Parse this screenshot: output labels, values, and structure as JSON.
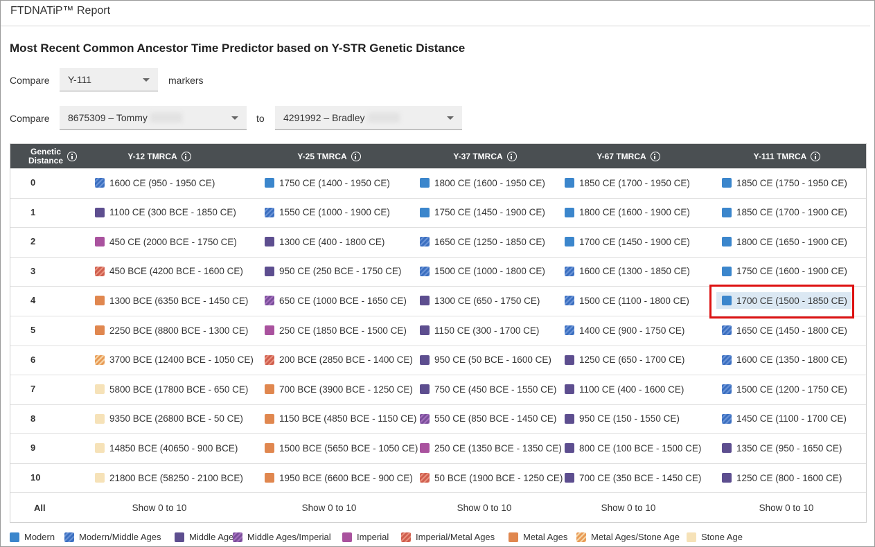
{
  "header": {
    "title": "FTDNATiP™ Report"
  },
  "page_title": "Most Recent Common Ancestor Time Predictor based on Y-STR Genetic Distance",
  "compare_markers": {
    "label": "Compare",
    "value": "Y-111",
    "suffix": "markers"
  },
  "compare_people": {
    "label": "Compare",
    "person1": "8675309 – Tommy",
    "to": "to",
    "person2": "4291992 – Bradley"
  },
  "table": {
    "headers": [
      "Genetic Distance",
      "Y-12 TMRCA",
      "Y-25 TMRCA",
      "Y-37 TMRCA",
      "Y-67 TMRCA",
      "Y-111 TMRCA"
    ],
    "rows": [
      {
        "gd": "0",
        "cells": [
          {
            "text": "1600 CE (950 - 1950 CE)",
            "era": "modern-middle"
          },
          {
            "text": "1750 CE (1400 - 1950 CE)",
            "era": "modern"
          },
          {
            "text": "1800 CE (1600 - 1950 CE)",
            "era": "modern"
          },
          {
            "text": "1850 CE (1700 - 1950 CE)",
            "era": "modern"
          },
          {
            "text": "1850 CE (1750 - 1950 CE)",
            "era": "modern"
          }
        ]
      },
      {
        "gd": "1",
        "cells": [
          {
            "text": "1100 CE (300 BCE - 1850 CE)",
            "era": "middle"
          },
          {
            "text": "1550 CE (1000 - 1900 CE)",
            "era": "modern-middle"
          },
          {
            "text": "1750 CE (1450 - 1900 CE)",
            "era": "modern"
          },
          {
            "text": "1800 CE (1600 - 1900 CE)",
            "era": "modern"
          },
          {
            "text": "1850 CE (1700 - 1900 CE)",
            "era": "modern"
          }
        ]
      },
      {
        "gd": "2",
        "cells": [
          {
            "text": "450 CE (2000 BCE - 1750 CE)",
            "era": "imperial"
          },
          {
            "text": "1300 CE (400 - 1800 CE)",
            "era": "middle"
          },
          {
            "text": "1650 CE (1250 - 1850 CE)",
            "era": "modern-middle"
          },
          {
            "text": "1700 CE (1450 - 1900 CE)",
            "era": "modern"
          },
          {
            "text": "1800 CE (1650 - 1900 CE)",
            "era": "modern"
          }
        ]
      },
      {
        "gd": "3",
        "cells": [
          {
            "text": "450 BCE (4200 BCE - 1600 CE)",
            "era": "imperial-metal"
          },
          {
            "text": "950 CE (250 BCE - 1750 CE)",
            "era": "middle"
          },
          {
            "text": "1500 CE (1000 - 1800 CE)",
            "era": "modern-middle"
          },
          {
            "text": "1600 CE (1300 - 1850 CE)",
            "era": "modern-middle"
          },
          {
            "text": "1750 CE (1600 - 1900 CE)",
            "era": "modern"
          }
        ]
      },
      {
        "gd": "4",
        "cells": [
          {
            "text": "1300 BCE (6350 BCE - 1450 CE)",
            "era": "metal"
          },
          {
            "text": "650 CE (1000 BCE - 1650 CE)",
            "era": "middle-imperial"
          },
          {
            "text": "1300 CE (650 - 1750 CE)",
            "era": "middle"
          },
          {
            "text": "1500 CE (1100 - 1800 CE)",
            "era": "modern-middle"
          },
          {
            "text": "1700 CE (1500 - 1850 CE)",
            "era": "modern"
          }
        ]
      },
      {
        "gd": "5",
        "cells": [
          {
            "text": "2250 BCE (8800 BCE - 1300 CE)",
            "era": "metal"
          },
          {
            "text": "250 CE (1850 BCE - 1500 CE)",
            "era": "imperial"
          },
          {
            "text": "1150 CE (300 - 1700 CE)",
            "era": "middle"
          },
          {
            "text": "1400 CE (900 - 1750 CE)",
            "era": "modern-middle"
          },
          {
            "text": "1650 CE (1450 - 1800 CE)",
            "era": "modern-middle"
          }
        ]
      },
      {
        "gd": "6",
        "cells": [
          {
            "text": "3700 BCE (12400 BCE - 1050 CE)",
            "era": "metal-stone"
          },
          {
            "text": "200 BCE (2850 BCE - 1400 CE)",
            "era": "imperial-metal"
          },
          {
            "text": "950 CE (50 BCE - 1600 CE)",
            "era": "middle"
          },
          {
            "text": "1250 CE (650 - 1700 CE)",
            "era": "middle"
          },
          {
            "text": "1600 CE (1350 - 1800 CE)",
            "era": "modern-middle"
          }
        ]
      },
      {
        "gd": "7",
        "cells": [
          {
            "text": "5800 BCE (17800 BCE - 650 CE)",
            "era": "stone"
          },
          {
            "text": "700 BCE (3900 BCE - 1250 CE)",
            "era": "metal"
          },
          {
            "text": "750 CE (450 BCE - 1550 CE)",
            "era": "middle"
          },
          {
            "text": "1100 CE (400 - 1600 CE)",
            "era": "middle"
          },
          {
            "text": "1500 CE (1200 - 1750 CE)",
            "era": "modern-middle"
          }
        ]
      },
      {
        "gd": "8",
        "cells": [
          {
            "text": "9350 BCE (26800 BCE - 50 CE)",
            "era": "stone"
          },
          {
            "text": "1150 BCE (4850 BCE - 1150 CE)",
            "era": "metal"
          },
          {
            "text": "550 CE (850 BCE - 1450 CE)",
            "era": "middle-imperial"
          },
          {
            "text": "950 CE (150 - 1550 CE)",
            "era": "middle"
          },
          {
            "text": "1450 CE (1100 - 1700 CE)",
            "era": "modern-middle"
          }
        ]
      },
      {
        "gd": "9",
        "cells": [
          {
            "text": "14850 BCE (40650 - 900 BCE)",
            "era": "stone"
          },
          {
            "text": "1500 BCE (5650 BCE - 1050 CE)",
            "era": "metal"
          },
          {
            "text": "250 CE (1350 BCE - 1350 CE)",
            "era": "imperial"
          },
          {
            "text": "800 CE (100 BCE - 1500 CE)",
            "era": "middle"
          },
          {
            "text": "1350 CE (950 - 1650 CE)",
            "era": "middle"
          }
        ]
      },
      {
        "gd": "10",
        "cells": [
          {
            "text": "21800 BCE (58250 - 2100 BCE)",
            "era": "stone"
          },
          {
            "text": "1950 BCE (6600 BCE - 900 CE)",
            "era": "metal"
          },
          {
            "text": "50 BCE (1900 BCE - 1250 CE)",
            "era": "imperial-metal"
          },
          {
            "text": "700 CE (350 BCE - 1450 CE)",
            "era": "middle"
          },
          {
            "text": "1250 CE (800 - 1600 CE)",
            "era": "middle"
          }
        ]
      }
    ],
    "highlighted": {
      "row": 4,
      "col": 4
    },
    "all_row": {
      "label": "All",
      "links": [
        "Show 0 to 10",
        "Show 0 to 10",
        "Show 0 to 10",
        "Show 0 to 10",
        "Show 0 to 10"
      ]
    }
  },
  "legend": [
    {
      "label": "Modern",
      "era": "modern"
    },
    {
      "label": "Modern/Middle Ages",
      "era": "modern-middle"
    },
    {
      "label": "Middle Ages",
      "era": "middle"
    },
    {
      "label": "Middle Ages/Imperial",
      "era": "middle-imperial"
    },
    {
      "label": "Imperial",
      "era": "imperial"
    },
    {
      "label": "Imperial/Metal Ages",
      "era": "imperial-metal"
    },
    {
      "label": "Metal Ages",
      "era": "metal"
    },
    {
      "label": "Metal Ages/Stone Age",
      "era": "metal-stone"
    },
    {
      "label": "Stone Age",
      "era": "stone"
    }
  ],
  "colors": {
    "header_bg": "#4a4f52",
    "modern": "#3b86cc",
    "middle": "#5d4e8f",
    "imperial": "#a9529e",
    "metal": "#e0874f",
    "stone": "#f6e2b8",
    "highlight_border": "#dd1111"
  }
}
